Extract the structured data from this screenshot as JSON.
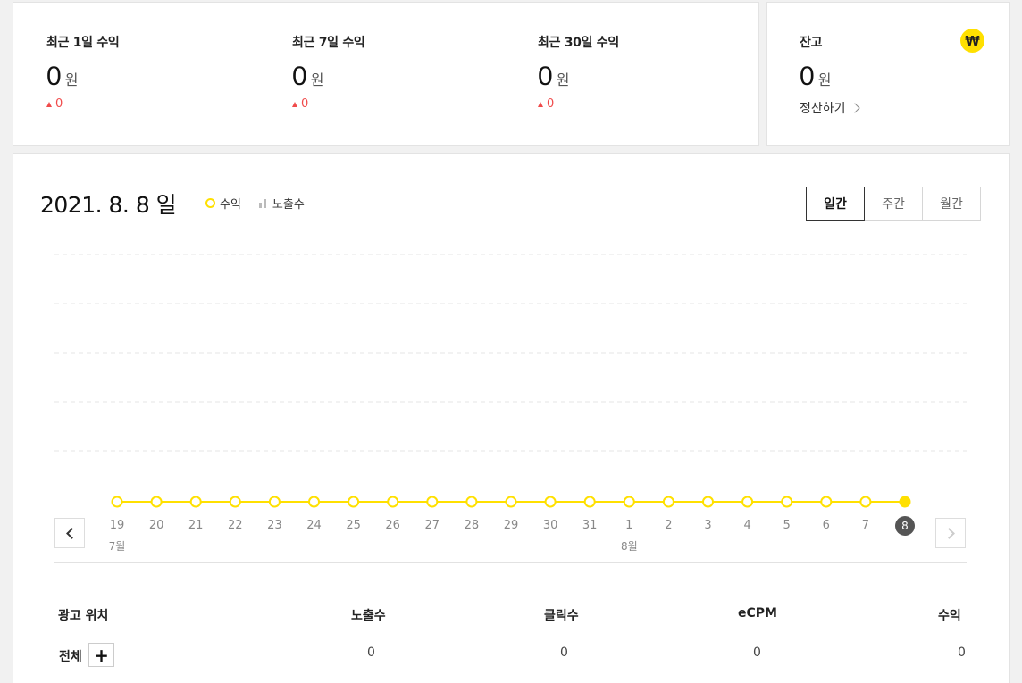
{
  "summary": {
    "stats": [
      {
        "label": "최근 1일 수익",
        "value": "0",
        "unit": "원",
        "change": "0"
      },
      {
        "label": "최근 7일 수익",
        "value": "0",
        "unit": "원",
        "change": "0"
      },
      {
        "label": "최근 30일 수익",
        "value": "0",
        "unit": "원",
        "change": "0"
      }
    ]
  },
  "balance": {
    "label": "잔고",
    "value": "0",
    "unit": "원",
    "icon": "won-icon",
    "icon_glyph": "₩",
    "settle_label": "정산하기"
  },
  "report": {
    "date_title": "2021. 8. 8 일",
    "legend": {
      "revenue": "수익",
      "impressions": "노출수"
    },
    "period_tabs": [
      {
        "label": "일간",
        "active": true
      },
      {
        "label": "주간",
        "active": false
      },
      {
        "label": "월간",
        "active": false
      }
    ]
  },
  "chart_data": {
    "type": "line",
    "x": [
      "19",
      "20",
      "21",
      "22",
      "23",
      "24",
      "25",
      "26",
      "27",
      "28",
      "29",
      "30",
      "31",
      "1",
      "2",
      "3",
      "4",
      "5",
      "6",
      "7",
      "8"
    ],
    "month_labels": [
      {
        "index": 0,
        "label": "7월"
      },
      {
        "index": 13,
        "label": "8월"
      }
    ],
    "series": [
      {
        "name": "수익",
        "values": [
          0,
          0,
          0,
          0,
          0,
          0,
          0,
          0,
          0,
          0,
          0,
          0,
          0,
          0,
          0,
          0,
          0,
          0,
          0,
          0,
          0
        ],
        "color": "#ffe000"
      }
    ],
    "selected_index": 20,
    "grid": true
  },
  "table": {
    "headers": [
      "광고 위치",
      "노출수",
      "클릭수",
      "eCPM",
      "수익"
    ],
    "rows": [
      {
        "name": "전체",
        "impressions": "0",
        "clicks": "0",
        "ecpm": "0",
        "revenue": "0"
      }
    ],
    "expand_glyph": "+"
  },
  "colors": {
    "accent": "#ffe000",
    "positive_change": "#f04b4b"
  }
}
